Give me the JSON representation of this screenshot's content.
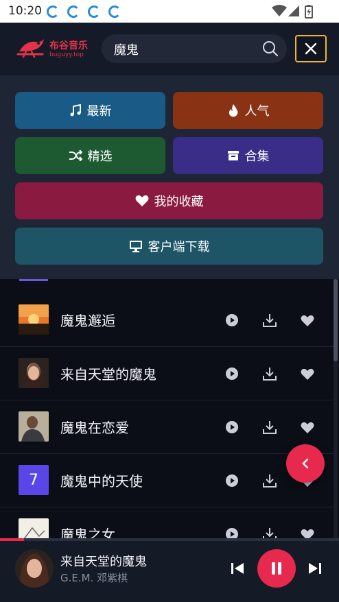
{
  "status_bar": {
    "time": "10:20",
    "notification_icons": [
      "sync-icon",
      "sync-icon",
      "sync-icon",
      "sync-icon"
    ]
  },
  "header": {
    "logo_title": "布谷音乐",
    "logo_subtitle": "buguyy.top",
    "search": {
      "value": "魔鬼",
      "placeholder": ""
    },
    "close_label": "×"
  },
  "menu": {
    "latest": {
      "label": "最新",
      "icon": "music-note-icon",
      "color": "#1a5a86"
    },
    "hot": {
      "label": "人气",
      "icon": "fire-icon",
      "color": "#8a3214"
    },
    "picks": {
      "label": "精选",
      "icon": "shuffle-icon",
      "color": "#1d5a32"
    },
    "collections": {
      "label": "合集",
      "icon": "archive-box-icon",
      "color": "#3a2d88"
    },
    "favorites": {
      "label": "我的收藏",
      "icon": "heart-icon",
      "color": "#8a1a40"
    },
    "client_download": {
      "label": "客户端下载",
      "icon": "desktop-icon",
      "color": "#1e5566"
    }
  },
  "songs": [
    {
      "title": "魔鬼邂逅",
      "cover": "sunset-cover"
    },
    {
      "title": "来自天堂的魔鬼",
      "cover": "portrait-cover"
    },
    {
      "title": "魔鬼在恋爱",
      "cover": "portrait-cover"
    },
    {
      "title": "魔鬼中的天使",
      "cover": "number-cover",
      "cover_text": "7"
    },
    {
      "title": "魔鬼之女",
      "cover": "sketch-cover"
    }
  ],
  "player": {
    "title": "来自天堂的魔鬼",
    "artist": "G.E.M. 邓紫棋",
    "progress": 0.07,
    "state": "playing"
  },
  "colors": {
    "accent": "#e8294e",
    "brand": "#e3324a",
    "close_border": "#f0b53a"
  }
}
